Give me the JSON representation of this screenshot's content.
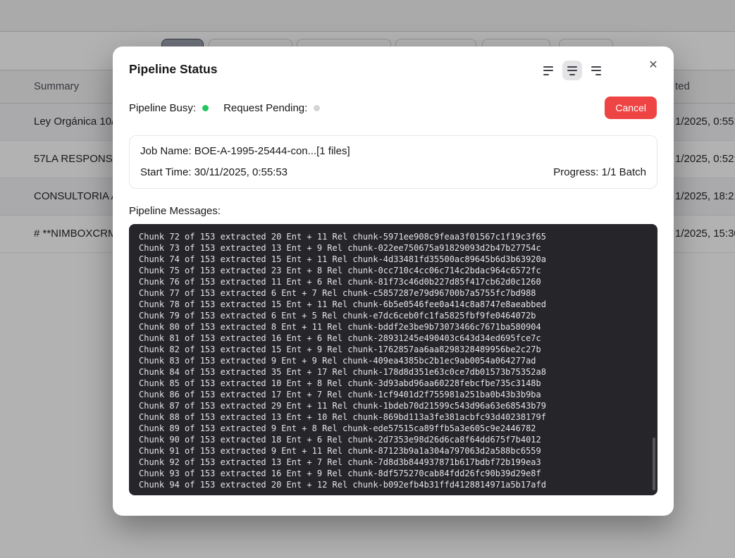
{
  "background": {
    "table": {
      "header": {
        "summary": "Summary",
        "right_fragment": "ted"
      },
      "rows": [
        {
          "summary": "Ley Orgánica 10/",
          "date_fragment": "1/2025, 0:55:"
        },
        {
          "summary": "57LA RESPONSA",
          "date_fragment": "1/2025, 0:52:"
        },
        {
          "summary": "CONSULTORIA A",
          "date_fragment": "1/2025, 18:21"
        },
        {
          "summary": "# **NIMBOXCRM",
          "date_fragment": "1/2025, 15:30"
        }
      ]
    }
  },
  "modal": {
    "title": "Pipeline Status",
    "close_glyph": "✕",
    "status": {
      "busy_label": "Pipeline Busy:",
      "busy_color": "#22c55e",
      "pending_label": "Request Pending:",
      "pending_color": "#d4d4d8",
      "cancel_label": "Cancel",
      "cancel_color": "#ef4444"
    },
    "job": {
      "name_line": "Job Name: BOE-A-1995-25444-con...[1 files]",
      "start_time_line": "Start Time: 30/11/2025, 0:55:53",
      "progress_line": "Progress: 1/1 Batch"
    },
    "messages_label": "Pipeline Messages:",
    "log_lines": [
      "Chunk 72 of 153 extracted 20 Ent + 11 Rel chunk-5971ee908c9feaa3f01567c1f19c3f65",
      "Chunk 73 of 153 extracted 13 Ent + 9 Rel chunk-022ee750675a91829093d2b47b27754c",
      "Chunk 74 of 153 extracted 15 Ent + 11 Rel chunk-4d33481fd35500ac89645b6d3b63920a",
      "Chunk 75 of 153 extracted 23 Ent + 8 Rel chunk-0cc710c4cc06c714c2bdac964c6572fc",
      "Chunk 76 of 153 extracted 11 Ent + 6 Rel chunk-81f73c46d0b227d85f417cb62d0c1260",
      "Chunk 77 of 153 extracted 6 Ent + 7 Rel chunk-c5857287e79d96700b7a5755fc7bd988",
      "Chunk 78 of 153 extracted 15 Ent + 11 Rel chunk-6b5e0546fee0a414c8a8747e8aeabbed",
      "Chunk 79 of 153 extracted 6 Ent + 5 Rel chunk-e7dc6ceb0fc1fa5825fbf9fe0464072b",
      "Chunk 80 of 153 extracted 8 Ent + 11 Rel chunk-bddf2e3be9b73073466c7671ba580904",
      "Chunk 81 of 153 extracted 16 Ent + 6 Rel chunk-28931245e490403c643d34ed695fce7c",
      "Chunk 82 of 153 extracted 15 Ent + 9 Rel chunk-1762857aa6aa8298328489956be2c27b",
      "Chunk 83 of 153 extracted 9 Ent + 9 Rel chunk-409ea4385bc2b1ec9ab0054a064277ad",
      "Chunk 84 of 153 extracted 35 Ent + 17 Rel chunk-178d8d351e63c0ce7db01573b75352a8",
      "Chunk 85 of 153 extracted 10 Ent + 8 Rel chunk-3d93abd96aa60228febcfbe735c3148b",
      "Chunk 86 of 153 extracted 17 Ent + 7 Rel chunk-1cf9401d2f755981a251ba0b43b3b9ba",
      "Chunk 87 of 153 extracted 29 Ent + 11 Rel chunk-1bdeb70d21599c543d96a63e68543b79",
      "Chunk 88 of 153 extracted 13 Ent + 10 Rel chunk-869bd113a3fe381acbfc93d40238179f",
      "Chunk 89 of 153 extracted 9 Ent + 8 Rel chunk-ede57515ca89ffb5a3e605c9e2446782",
      "Chunk 90 of 153 extracted 18 Ent + 6 Rel chunk-2d7353e98d26d6ca8f64dd675f7b4012",
      "Chunk 91 of 153 extracted 9 Ent + 11 Rel chunk-87123b9a1a304a797063d2a588bc6559",
      "Chunk 92 of 153 extracted 13 Ent + 7 Rel chunk-7d8d3b844937871b617bdbf72b199ea3",
      "Chunk 93 of 153 extracted 16 Ent + 9 Rel chunk-8df575270cab84fdd26fc90b39d29e8f",
      "Chunk 94 of 153 extracted 20 Ent + 12 Rel chunk-b092efb4b31ffd4128814971a5b17afd"
    ]
  }
}
